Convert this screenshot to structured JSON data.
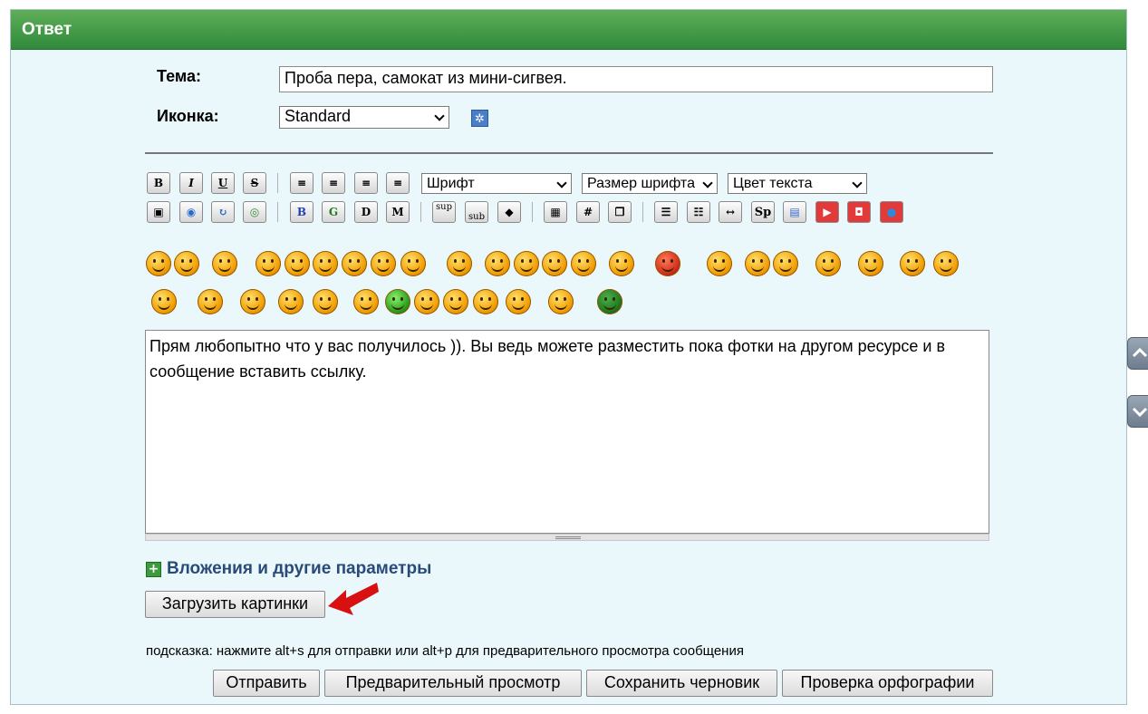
{
  "panel": {
    "title": "Ответ"
  },
  "subject": {
    "label": "Тема:",
    "value": "Проба пера, самокат из мини-сигвея."
  },
  "icon": {
    "label": "Иконка:",
    "selected": "Standard"
  },
  "toolbar": {
    "row1": {
      "bold": "B",
      "italic": "I",
      "underline": "U",
      "strike": "S",
      "font": "Шрифт",
      "size": "Размер шрифта",
      "color": "Цвет текста"
    },
    "row2": {
      "sup": "sup",
      "sub": "sub",
      "hash": "#",
      "spoiler": "Sp",
      "b2": "B",
      "g": "G",
      "m": "M"
    }
  },
  "message": {
    "text": "Прям любопытно что у вас получилось )). Вы ведь можете разместить пока фотки на другом ресурсе и в сообщение вставить ссылку."
  },
  "attachments": {
    "label": "Вложения и другие параметры"
  },
  "upload": {
    "label": "Загрузить картинки"
  },
  "hint": {
    "text": "подсказка: нажмите alt+s для отправки или alt+p для предварительного просмотра сообщения"
  },
  "actions": {
    "send": "Отправить",
    "preview": "Предварительный просмотр",
    "draft": "Сохранить черновик",
    "spell": "Проверка орфографии"
  },
  "colors": {
    "header": "#3a9a45",
    "panel": "#eaf8fb",
    "arrow": "#d81010"
  }
}
